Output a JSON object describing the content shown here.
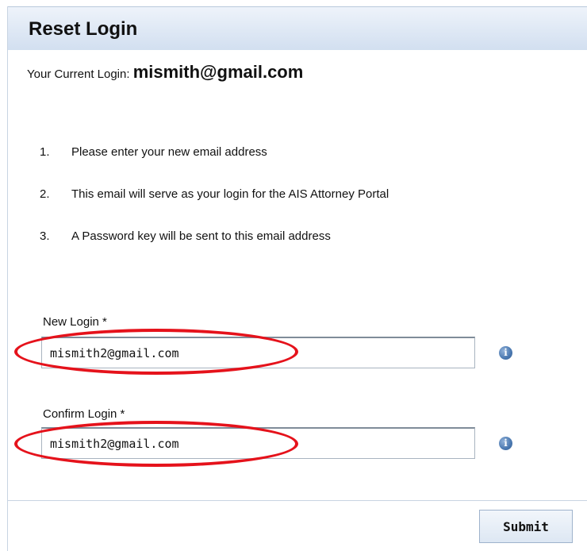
{
  "header": {
    "title": "Reset Login"
  },
  "current_login": {
    "label": "Your Current Login: ",
    "value": "mismith@gmail.com"
  },
  "instructions": [
    {
      "number": "1.",
      "text": "Please enter your new email address"
    },
    {
      "number": "2.",
      "text": "This email will serve as your login for the AIS Attorney Portal"
    },
    {
      "number": "3.",
      "text": "A Password key will be sent to this email address"
    }
  ],
  "form": {
    "new_login": {
      "label": "New Login *",
      "value": "mismith2@gmail.com"
    },
    "confirm_login": {
      "label": "Confirm Login *",
      "value": "mismith2@gmail.com"
    }
  },
  "actions": {
    "submit_label": "Submit"
  },
  "icons": {
    "info_glyph": "i"
  },
  "colors": {
    "header_bg": "#dde7f4",
    "annotation_red": "#e5121b",
    "info_blue": "#4a78b0"
  }
}
